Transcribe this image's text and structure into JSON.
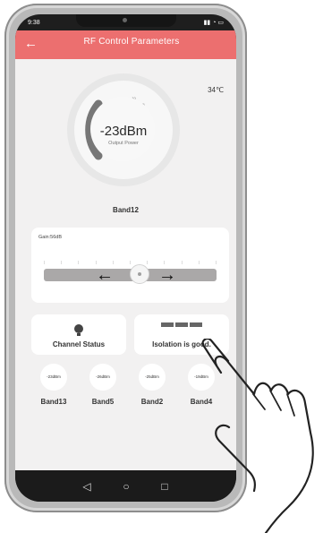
{
  "status": {
    "time": "9:38"
  },
  "header": {
    "title": "RF Control Parameters"
  },
  "temperature": "34℃",
  "gauge": {
    "value": "-23dBm",
    "label": "Output Power",
    "ticks": [
      "-20",
      "-15",
      "-10",
      "-5",
      "0",
      "5",
      "10",
      "15",
      "20",
      "-25",
      "-30"
    ]
  },
  "current_band": "Band12",
  "gain": {
    "label": "Gain:56dB"
  },
  "cards": {
    "channel_status": "Channel Status",
    "isolation": "Isolation is good."
  },
  "bands": [
    {
      "value": "-23dBm",
      "name": "Band13"
    },
    {
      "value": "-26dBm",
      "name": "Band5"
    },
    {
      "value": "-25dBm",
      "name": "Band2"
    },
    {
      "value": "-19dBm",
      "name": "Band4"
    }
  ]
}
